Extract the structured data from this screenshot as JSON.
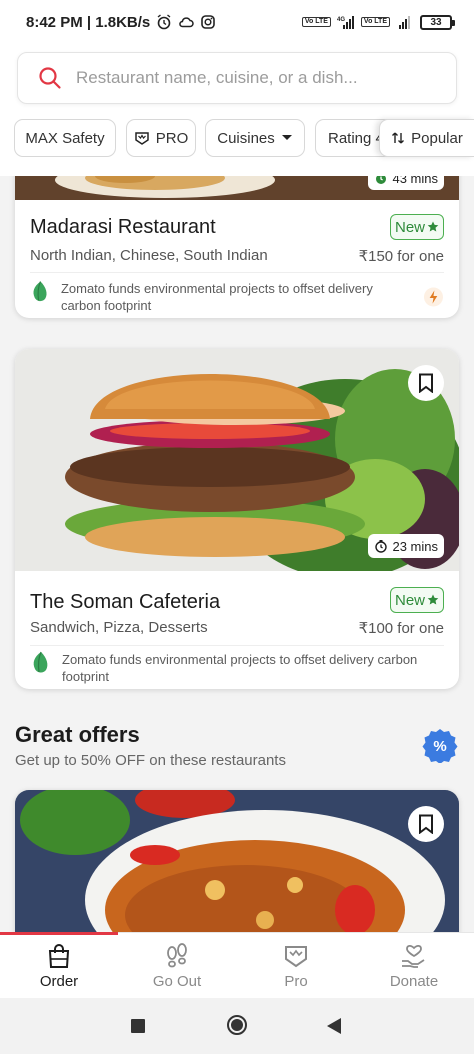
{
  "status": {
    "time_speed": "8:42 PM | 1.8KB/s",
    "net1": "Vo LTE",
    "net2": "4G",
    "net3": "Vo LTE",
    "battery": "33"
  },
  "search": {
    "placeholder": "Restaurant name, cuisine, or a dish..."
  },
  "filters": [
    {
      "label": "MAX Safety"
    },
    {
      "label": "PRO"
    },
    {
      "label": "Cuisines"
    },
    {
      "label": "Rating 4"
    },
    {
      "label": "Popular"
    }
  ],
  "cards": [
    {
      "name": "Madarasi Restaurant",
      "badge": "New",
      "cuisines": "North Indian, Chinese, South Indian",
      "price": "₹150 for one",
      "eco_text": "Zomato funds environmental projects to offset delivery carbon footprint",
      "delivery_time": "43 mins"
    },
    {
      "name": "The Soman Cafeteria",
      "badge": "New",
      "cuisines": "Sandwich, Pizza, Desserts",
      "price": "₹100 for one",
      "eco_text": "Zomato funds environmental projects to offset delivery carbon footprint",
      "delivery_time": "23 mins"
    }
  ],
  "offers": {
    "title": "Great offers",
    "subtitle": "Get up to 50% OFF on these restaurants",
    "badge": "%"
  },
  "bottom_nav": [
    {
      "label": "Order"
    },
    {
      "label": "Go Out"
    },
    {
      "label": "Pro"
    },
    {
      "label": "Donate"
    }
  ],
  "colors": {
    "brand_red": "#e23744",
    "new_green": "#2e8b3a",
    "eco_green": "#3ba55c"
  }
}
